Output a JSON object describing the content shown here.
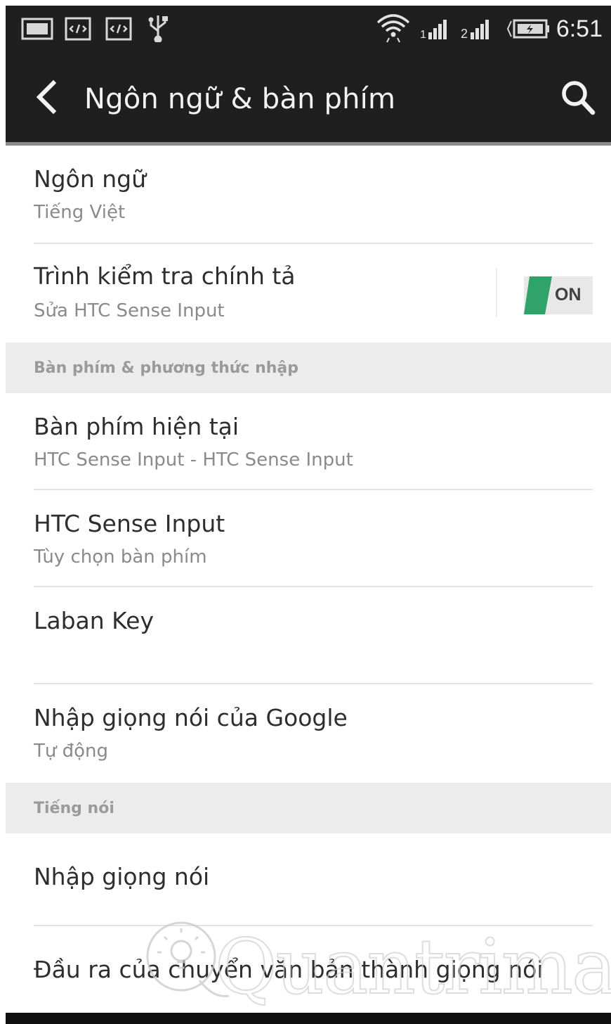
{
  "status_bar": {
    "time": "6:51",
    "icons": [
      "screenshot-icon",
      "code-icon",
      "code-icon",
      "usb-icon",
      "wifi-icon",
      "signal-1-icon",
      "signal-2-icon",
      "battery-charging-icon"
    ]
  },
  "header": {
    "title": "Ngôn ngữ & bàn phím",
    "back_icon": "back-arrow-icon",
    "search_icon": "search-icon"
  },
  "items": [
    {
      "title": "Ngôn ngữ",
      "subtitle": "Tiếng Việt"
    },
    {
      "title": "Trình kiểm tra chính tả",
      "subtitle": "Sửa HTC Sense Input",
      "toggle": "ON"
    }
  ],
  "section_keyboard": {
    "label": "Bàn phím & phương thức nhập",
    "items": [
      {
        "title": "Bàn phím hiện tại",
        "subtitle": "HTC Sense Input - HTC Sense Input"
      },
      {
        "title": "HTC Sense Input",
        "subtitle": "Tùy chọn bàn phím"
      },
      {
        "title": "Laban Key"
      },
      {
        "title": "Nhập giọng nói của Google",
        "subtitle": "Tự động"
      }
    ]
  },
  "section_speech": {
    "label": "Tiếng nói",
    "items": [
      {
        "title": "Nhập giọng nói"
      },
      {
        "title": "Đầu ra của chuyển văn bản thành giọng nói"
      }
    ]
  },
  "watermark": "Quantrimang",
  "colors": {
    "bar_bg": "#1f1f1f",
    "toggle_on": "#2fa36a",
    "section_bg": "#ececec"
  }
}
